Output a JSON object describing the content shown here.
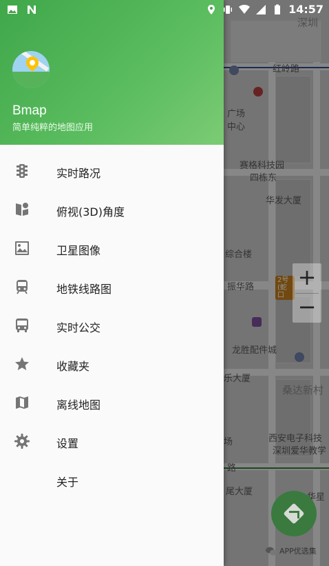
{
  "status_bar": {
    "time": "14:57"
  },
  "drawer": {
    "app_name": "Bmap",
    "app_subtitle": "简单纯粹的地图应用",
    "items": [
      {
        "label": "实时路况",
        "icon": "traffic-light-icon"
      },
      {
        "label": "俯视(3D)角度",
        "icon": "3d-view-icon"
      },
      {
        "label": "卫星图像",
        "icon": "satellite-image-icon"
      },
      {
        "label": "地铁线路图",
        "icon": "subway-icon"
      },
      {
        "label": "实时公交",
        "icon": "bus-icon"
      },
      {
        "label": "收藏夹",
        "icon": "star-icon"
      },
      {
        "label": "离线地图",
        "icon": "map-icon"
      },
      {
        "label": "设置",
        "icon": "gear-icon"
      },
      {
        "label": "关于",
        "icon": ""
      }
    ]
  },
  "map": {
    "labels": [
      "深圳",
      "赛格科技园",
      "四栋东",
      "华发大厦",
      "综合楼",
      "振华路",
      "龙胜配件城",
      "乐大厦",
      "桑达新村",
      "西安电子科技",
      "深圳爱华教学",
      "路",
      "华星",
      "广场",
      "中心",
      "红岭路",
      "尾大厦",
      "场"
    ],
    "metro_badge": "2号 (蛇口"
  },
  "zoom": {
    "plus": "+",
    "minus": "−"
  },
  "watermark": {
    "text": "APP优选集"
  },
  "colors": {
    "header_green": "#4caf50",
    "fab_green": "#3a7a3f",
    "icon_gray": "#757575"
  }
}
